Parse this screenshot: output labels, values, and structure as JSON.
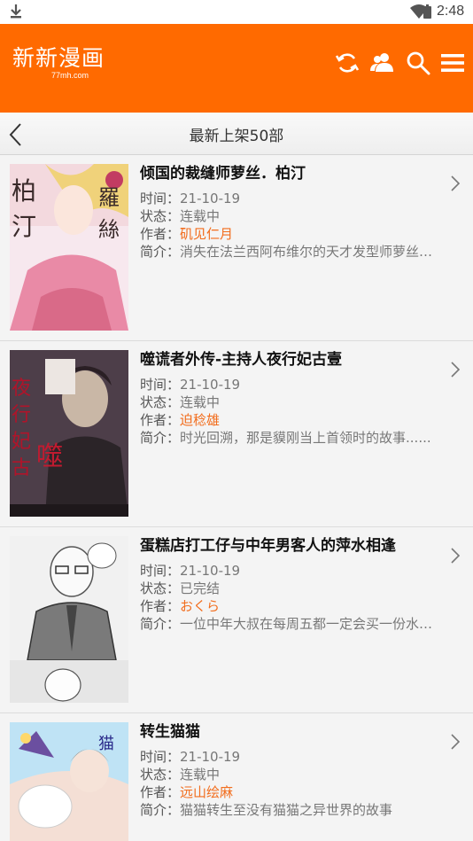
{
  "status_bar": {
    "time": "2:48"
  },
  "app": {
    "logo_text": "新新漫画",
    "logo_domain": "77mh.com",
    "brand_color": "#ff6a00"
  },
  "nav": {
    "title": "最新上架50部"
  },
  "labels": {
    "time": "时间：",
    "status": "状态：",
    "author": "作者：",
    "intro": "简介："
  },
  "comics": [
    {
      "title": "倾国的裁缝师萝丝．柏汀",
      "date": "21-10-19",
      "status": "连载中",
      "author": "矶见仁月",
      "summary": "消失在法兰西阿布维尔的天才发型师萝丝．柏汀，以裁缝师的身份出现在凡尔赛宫廷"
    },
    {
      "title": "噬谎者外传-主持人夜行妃古壹",
      "date": "21-10-19",
      "status": "连载中",
      "author": "迫稔雄",
      "summary": "时光回溯，那是貘刚当上首领时的故事......"
    },
    {
      "title": "蛋糕店打工仔与中年男客人的萍水相逢",
      "date": "21-10-19",
      "status": "已完结",
      "author": "おくら",
      "summary": "一位中年大叔在每周五都一定会买一份水果挞的故事"
    },
    {
      "title": "转生猫猫",
      "date": "21-10-19",
      "status": "连载中",
      "author": "远山绘麻",
      "summary": "猫猫转生至没有猫猫之异世界的故事"
    }
  ]
}
